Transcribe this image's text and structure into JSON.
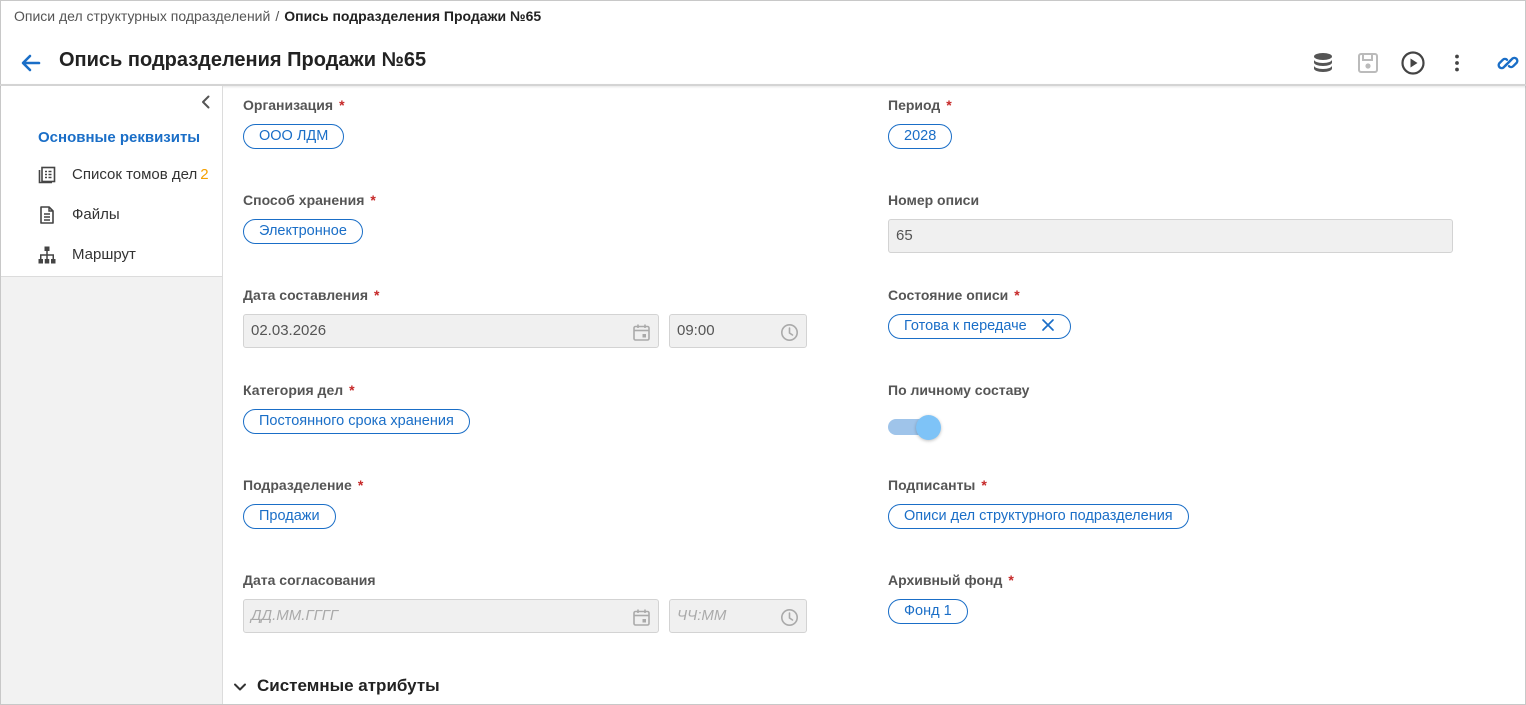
{
  "breadcrumb": {
    "parent": "Описи дел структурных подразделений",
    "separator": "/",
    "current": "Опись подразделения Продажи №65"
  },
  "header": {
    "title": "Опись подразделения Продажи №65",
    "toolbar_icons": [
      "database-icon",
      "save-icon",
      "play-icon",
      "more-vert-icon",
      "link-icon"
    ]
  },
  "sidebar": {
    "active_item": "Основные реквизиты",
    "items": [
      {
        "label": "Список томов дел",
        "count": "2",
        "icon": "volumes-icon"
      },
      {
        "label": "Файлы",
        "count": "",
        "icon": "file-icon"
      },
      {
        "label": "Маршрут",
        "count": "",
        "icon": "route-icon"
      }
    ]
  },
  "form": {
    "organization": {
      "label": "Организация",
      "required": "*",
      "value": "ООО ЛДМ"
    },
    "period": {
      "label": "Период",
      "required": "*",
      "value": "2028"
    },
    "storage_method": {
      "label": "Способ хранения",
      "required": "*",
      "value": "Электронное"
    },
    "inventory_number": {
      "label": "Номер описи",
      "value": "65"
    },
    "creation_date": {
      "label": "Дата составления",
      "required": "*",
      "date": "02.03.2026",
      "time": "09:00"
    },
    "inventory_state": {
      "label": "Состояние описи",
      "required": "*",
      "value": "Готова к передаче"
    },
    "case_category": {
      "label": "Категория дел",
      "required": "*",
      "value": "Постоянного срока хранения"
    },
    "by_personnel": {
      "label": "По личному составу",
      "value": true
    },
    "department": {
      "label": "Подразделение",
      "required": "*",
      "value": "Продажи"
    },
    "signatories": {
      "label": "Подписанты",
      "required": "*",
      "value": "Описи дел структурного подразделения"
    },
    "approval_date": {
      "label": "Дата согласования",
      "date_placeholder": "ДД.ММ.ГГГГ",
      "time_placeholder": "ЧЧ:ММ"
    },
    "archive_fund": {
      "label": "Архивный фонд",
      "required": "*",
      "value": "Фонд 1"
    }
  },
  "system_section": {
    "label": "Системные атрибуты"
  },
  "colors": {
    "accent": "#1a6ec7",
    "required": "#c62828",
    "count": "#f5a000"
  }
}
